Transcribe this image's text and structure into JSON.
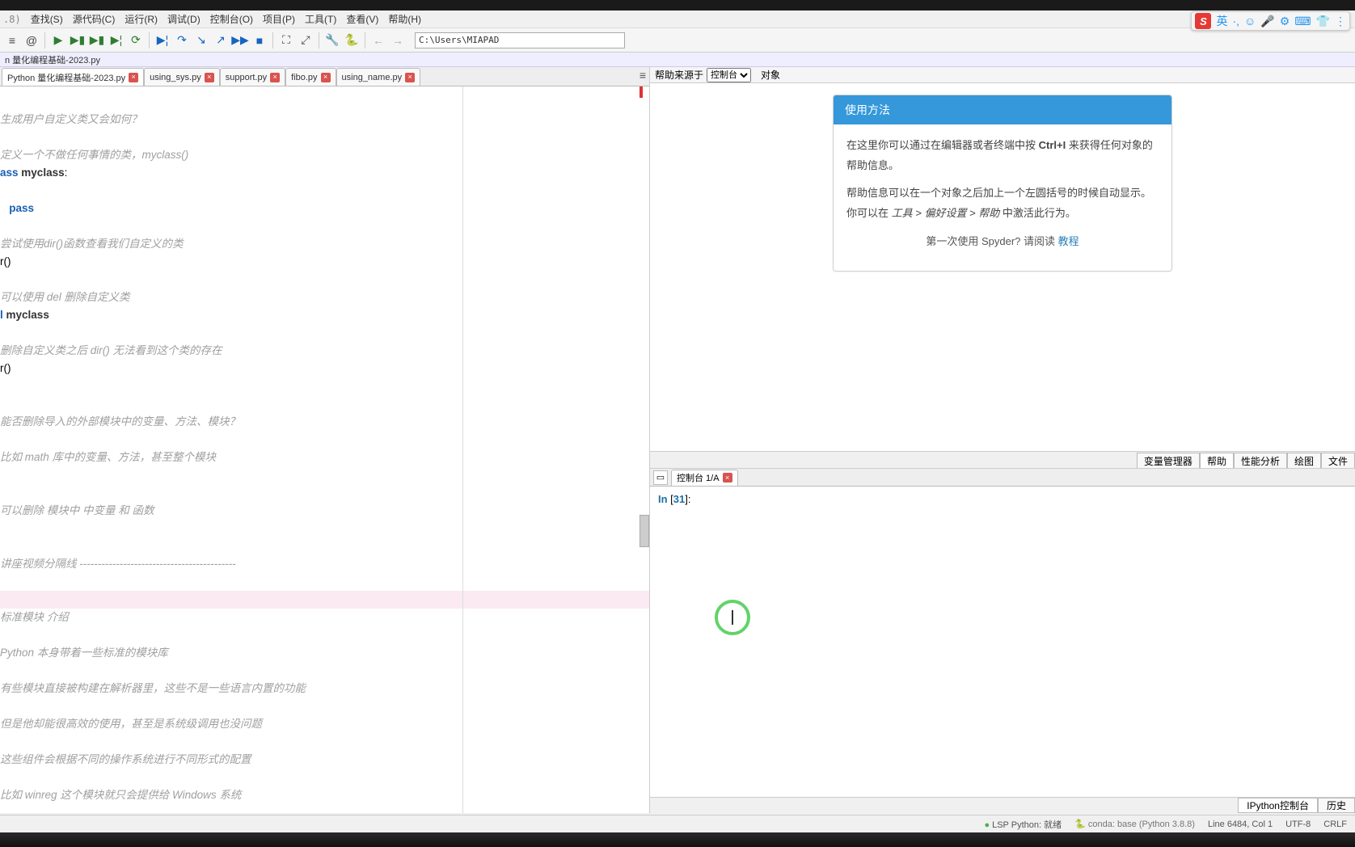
{
  "ime": {
    "s": "S",
    "lang": "英",
    "dots": "·,",
    "icons": [
      "☺",
      "🎤",
      "⚙",
      "⌨",
      "👕",
      "⋮"
    ]
  },
  "menu": [
    "查找(S)",
    "源代码(C)",
    "运行(R)",
    "调试(D)",
    "控制台(O)",
    "项目(P)",
    "工具(T)",
    "查看(V)",
    "帮助(H)"
  ],
  "toolbar": {
    "path": "C:\\Users\\MIAPAD"
  },
  "crumb": "n 量化编程基础-2023.py",
  "tabs": [
    {
      "label": "Python 量化编程基础-2023.py",
      "active": true,
      "x": true
    },
    {
      "label": "using_sys.py",
      "x": true
    },
    {
      "label": "support.py",
      "x": true
    },
    {
      "label": "fibo.py",
      "x": true
    },
    {
      "label": "using_name.py",
      "x": true
    }
  ],
  "code": [
    {
      "t": "",
      "cls": ""
    },
    {
      "t": "生成用户自定义类又会如何？",
      "cls": "c-cmt"
    },
    {
      "t": "",
      "cls": ""
    },
    {
      "t": "定义一个不做任何事情的类，myclass()",
      "cls": "c-cmt"
    },
    {
      "t": "ass <b>myclass</b>:",
      "cls": "raw-kw"
    },
    {
      "t": "",
      "cls": ""
    },
    {
      "t": "   pass",
      "cls": "raw-kw2"
    },
    {
      "t": "",
      "cls": ""
    },
    {
      "t": "尝试使用dir()函数查看我们自定义的类",
      "cls": "c-cmt"
    },
    {
      "t": "r()",
      "cls": ""
    },
    {
      "t": "",
      "cls": ""
    },
    {
      "t": "可以使用 del 删除自定义类",
      "cls": "c-cmt"
    },
    {
      "t": "l myclass",
      "cls": "raw-id"
    },
    {
      "t": "",
      "cls": ""
    },
    {
      "t": "删除自定义类之后 dir() 无法看到这个类的存在",
      "cls": "c-cmt"
    },
    {
      "t": "r()",
      "cls": ""
    },
    {
      "t": "",
      "cls": ""
    },
    {
      "t": "",
      "cls": ""
    },
    {
      "t": "能否删除导入的外部模块中的变量、方法、模块？",
      "cls": "c-cmt"
    },
    {
      "t": "",
      "cls": ""
    },
    {
      "t": "比如 math 库中的变量、方法，甚至整个模块",
      "cls": "c-cmt"
    },
    {
      "t": "",
      "cls": ""
    },
    {
      "t": "",
      "cls": ""
    },
    {
      "t": "可以删除 模块中 中变量 和 函数",
      "cls": "c-cmt"
    },
    {
      "t": "",
      "cls": ""
    },
    {
      "t": "",
      "cls": ""
    },
    {
      "t": "讲座视频分隔线 -------------------------------------------",
      "cls": "c-cmt"
    },
    {
      "t": "",
      "cls": ""
    },
    {
      "t": "",
      "cls": "hl"
    },
    {
      "t": "标准模块 介绍",
      "cls": "c-cmt"
    },
    {
      "t": "",
      "cls": ""
    },
    {
      "t": "Python 本身带着一些标准的模块库",
      "cls": "c-cmt"
    },
    {
      "t": "",
      "cls": ""
    },
    {
      "t": "有些模块直接被构建在解析器里，这些不是一些语言内置的功能",
      "cls": "c-cmt"
    },
    {
      "t": "",
      "cls": ""
    },
    {
      "t": "但是他却能很高效的使用，甚至是系统级调用也没问题",
      "cls": "c-cmt"
    },
    {
      "t": "",
      "cls": ""
    },
    {
      "t": "这些组件会根据不同的操作系统进行不同形式的配置",
      "cls": "c-cmt"
    },
    {
      "t": "",
      "cls": ""
    },
    {
      "t": "比如 winreg 这个模块就只会提供给 Windows 系统",
      "cls": "c-cmt"
    },
    {
      "t": "",
      "cls": ""
    }
  ],
  "help": {
    "sourceLabel": "帮助来源于",
    "sourceOpt": "控制台",
    "objLabel": "对象",
    "card_title": "使用方法",
    "p1a": "在这里你可以通过在编辑器或者终端中按 ",
    "p1b": "Ctrl+I",
    "p1c": " 来获得任何对象的帮助信息。",
    "p2a": "帮助信息可以在一个对象之后加上一个左圆括号的时候自动显示。 你可以在 ",
    "p2b": "工具 > 偏好设置 > 帮助",
    "p2c": " 中激活此行为。",
    "foot1": "第一次使用 Spyder? 请阅读 ",
    "foot_link": "教程"
  },
  "rtabs": [
    "变量管理器",
    "帮助",
    "性能分析",
    "绘图",
    "文件"
  ],
  "rtab_active": 1,
  "console": {
    "tab": "控制台 1/A",
    "prompt_in": "In ",
    "prompt_n": "31",
    "bottom_tabs": [
      "IPython控制台",
      "历史"
    ],
    "bottom_active": 0
  },
  "status": {
    "lsp": "LSP Python: 就绪",
    "conda": "conda: base (Python 3.8.8)",
    "pos": "Line 6484, Col 1",
    "enc": "UTF-8",
    "eol": "CRLF"
  },
  "titlebar_fragment": ".8)"
}
